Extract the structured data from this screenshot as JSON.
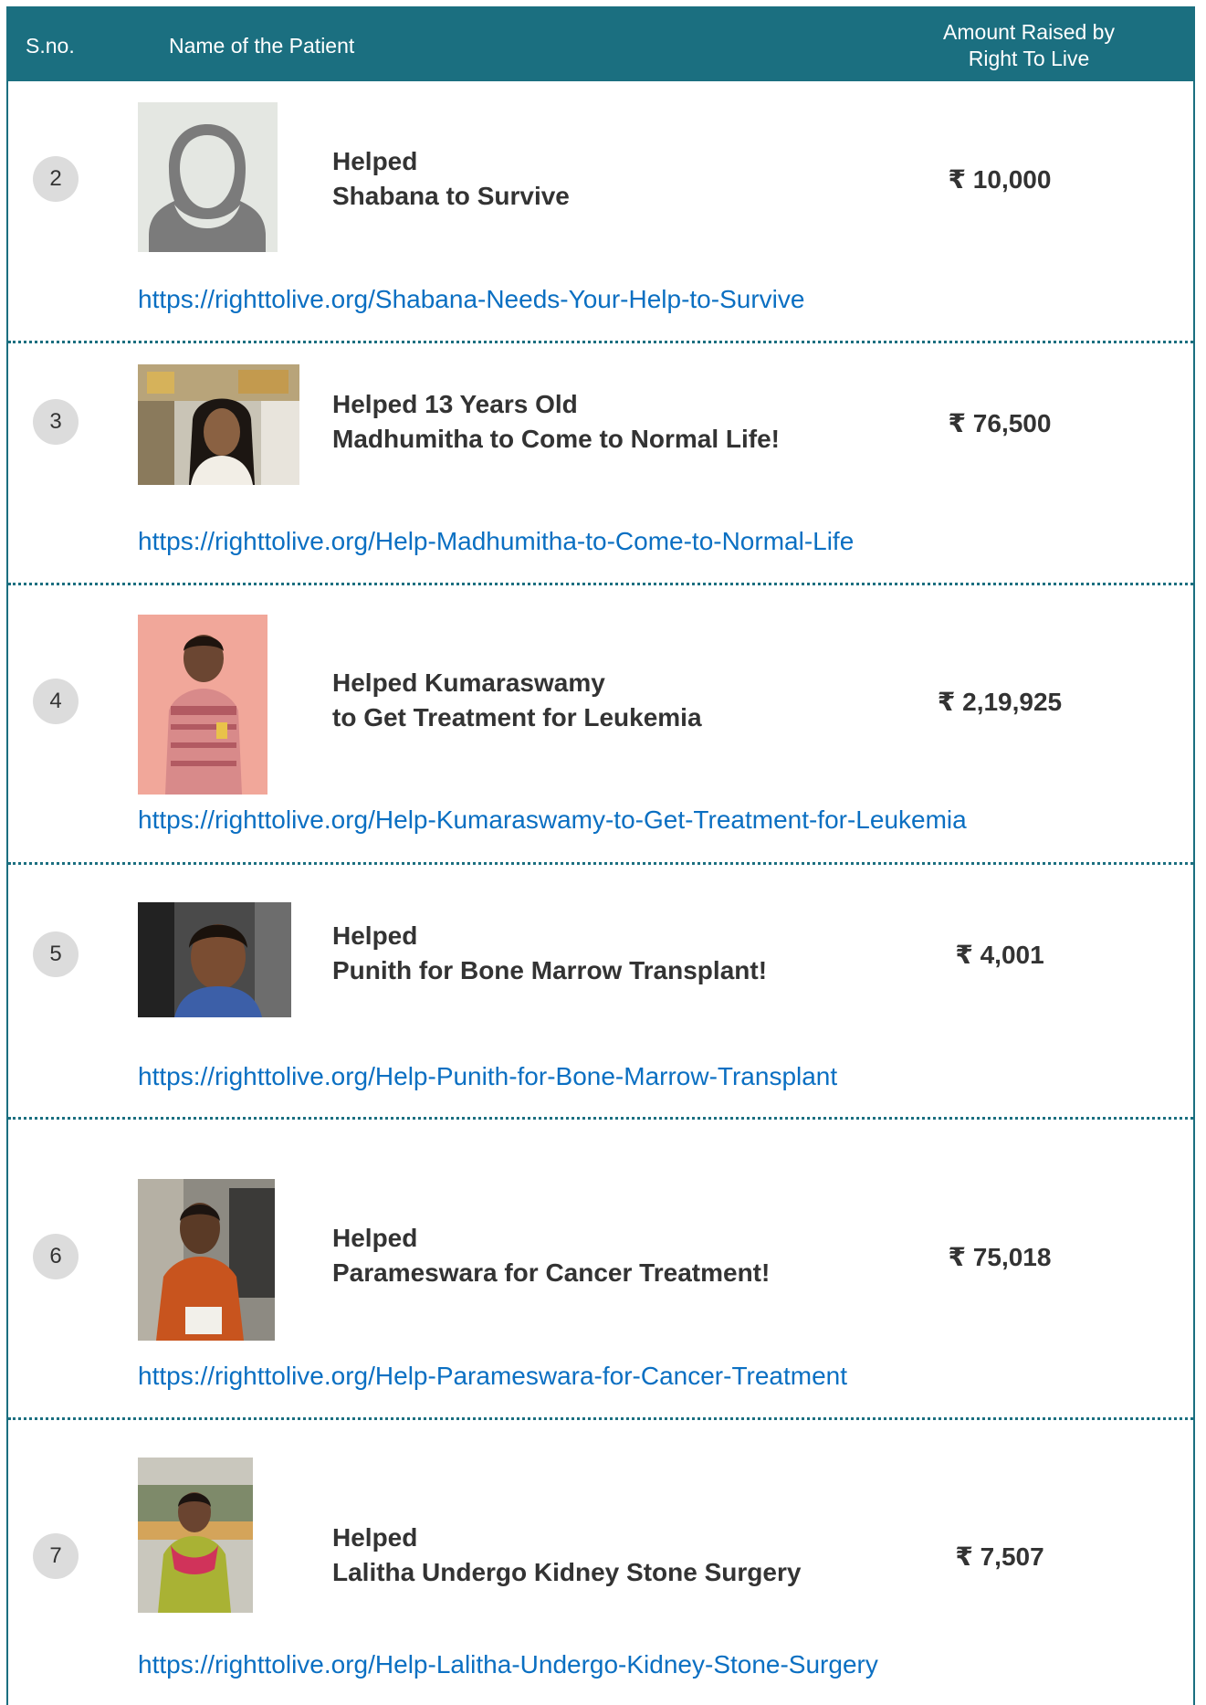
{
  "header": {
    "sno": "S.no.",
    "name": "Name of the Patient",
    "amount_line1": "Amount Raised by",
    "amount_line2": "Right To Live"
  },
  "colors": {
    "header_bg": "#1b6f80",
    "link": "#0a6fc2",
    "badge_bg": "#dcdcdc",
    "text": "#333333"
  },
  "rows": [
    {
      "sno": "2",
      "title_line1": "Helped",
      "title_line2": "Shabana to Survive",
      "amount": "₹ 10,000",
      "link": "https://righttolive.org/Shabana-Needs-Your-Help-to-Survive",
      "photo": "placeholder-avatar-icon"
    },
    {
      "sno": "3",
      "title_line1": "Helped 13 Years Old",
      "title_line2": "Madhumitha to Come to Normal Life!",
      "amount": "₹ 76,500",
      "link": "https://righttolive.org/Help-Madhumitha-to-Come-to-Normal-Life"
    },
    {
      "sno": "4",
      "title_line1": "Helped Kumaraswamy",
      "title_line2": "to Get Treatment for Leukemia",
      "amount": "₹ 2,19,925",
      "link": "https://righttolive.org/Help-Kumaraswamy-to-Get-Treatment-for-Leukemia"
    },
    {
      "sno": "5",
      "title_line1": "Helped",
      "title_line2": "Punith for Bone Marrow Transplant!",
      "amount": "₹ 4,001",
      "link": "https://righttolive.org/Help-Punith-for-Bone-Marrow-Transplant"
    },
    {
      "sno": "6",
      "title_line1": "Helped",
      "title_line2": "Parameswara for Cancer Treatment!",
      "amount": "₹ 75,018",
      "link": "https://righttolive.org/Help-Parameswara-for-Cancer-Treatment"
    },
    {
      "sno": "7",
      "title_line1": "Helped",
      "title_line2": "Lalitha Undergo Kidney Stone Surgery",
      "amount": "₹ 7,507",
      "link": "https://righttolive.org/Help-Lalitha-Undergo-Kidney-Stone-Surgery"
    }
  ]
}
